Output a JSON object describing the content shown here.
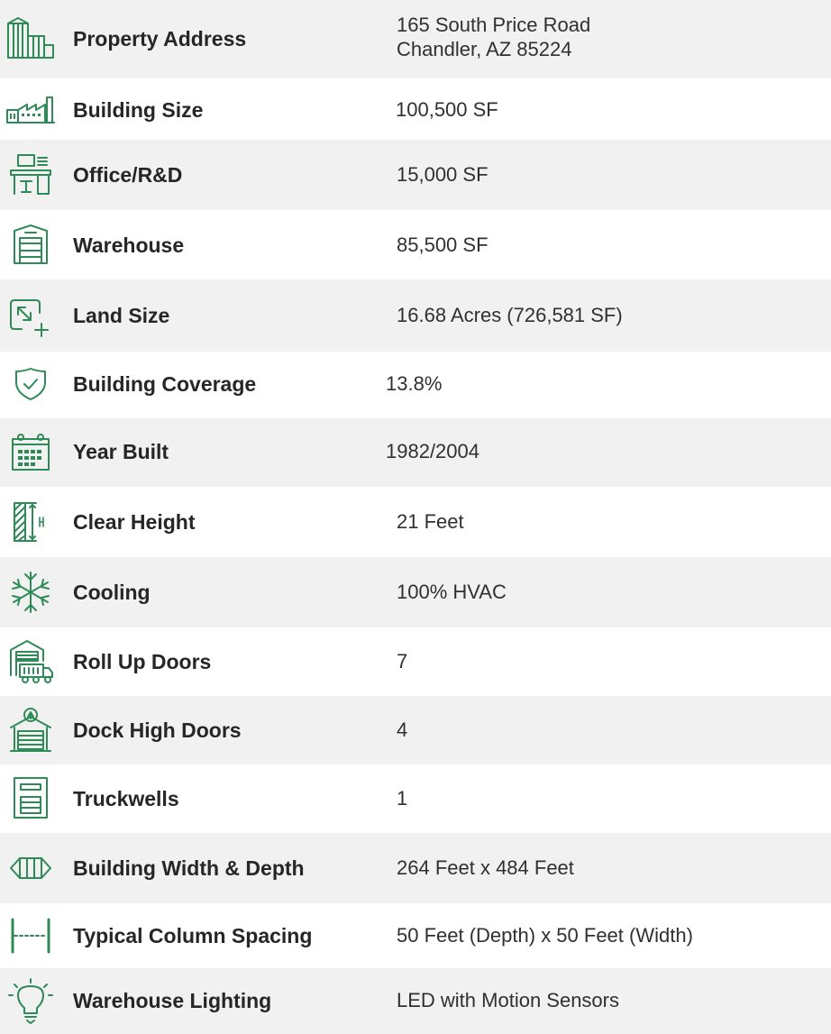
{
  "rows": [
    {
      "label": "Property Address",
      "value_line1": "165 South Price Road",
      "value_line2": "Chandler, AZ 85224",
      "icon": "buildings-icon"
    },
    {
      "label": "Building Size",
      "value": "100,500 SF",
      "icon": "factory-icon"
    },
    {
      "label": "Office/R&D",
      "value": "15,000 SF",
      "icon": "office-desk-icon"
    },
    {
      "label": "Warehouse",
      "value": "85,500 SF",
      "icon": "warehouse-icon"
    },
    {
      "label": "Land Size",
      "value": "16.68 Acres (726,581 SF)",
      "icon": "land-resize-icon"
    },
    {
      "label": "Building Coverage",
      "value": "13.8%",
      "icon": "shield-check-icon"
    },
    {
      "label": "Year Built",
      "value": "1982/2004",
      "icon": "calendar-icon"
    },
    {
      "label": "Clear Height",
      "value": "21 Feet",
      "icon": "clear-height-icon"
    },
    {
      "label": "Cooling",
      "value": "100% HVAC",
      "icon": "snowflake-icon"
    },
    {
      "label": "Roll Up Doors",
      "value": "7",
      "icon": "truck-garage-icon"
    },
    {
      "label": "Dock High Doors",
      "value": "4",
      "icon": "dock-door-icon"
    },
    {
      "label": "Truckwells",
      "value": "1",
      "icon": "truckwell-icon"
    },
    {
      "label": "Building Width & Depth",
      "value": "264 Feet x 484 Feet",
      "icon": "width-depth-icon"
    },
    {
      "label": "Typical Column Spacing",
      "value": "50 Feet (Depth) x 50 Feet (Width)",
      "icon": "column-spacing-icon"
    },
    {
      "label": "Warehouse Lighting",
      "value": "LED with Motion Sensors",
      "icon": "lightbulb-icon"
    }
  ],
  "colors": {
    "accent": "#2e8b57",
    "stripe": "#f1f1f1",
    "label": "#262626",
    "value": "#303030"
  }
}
